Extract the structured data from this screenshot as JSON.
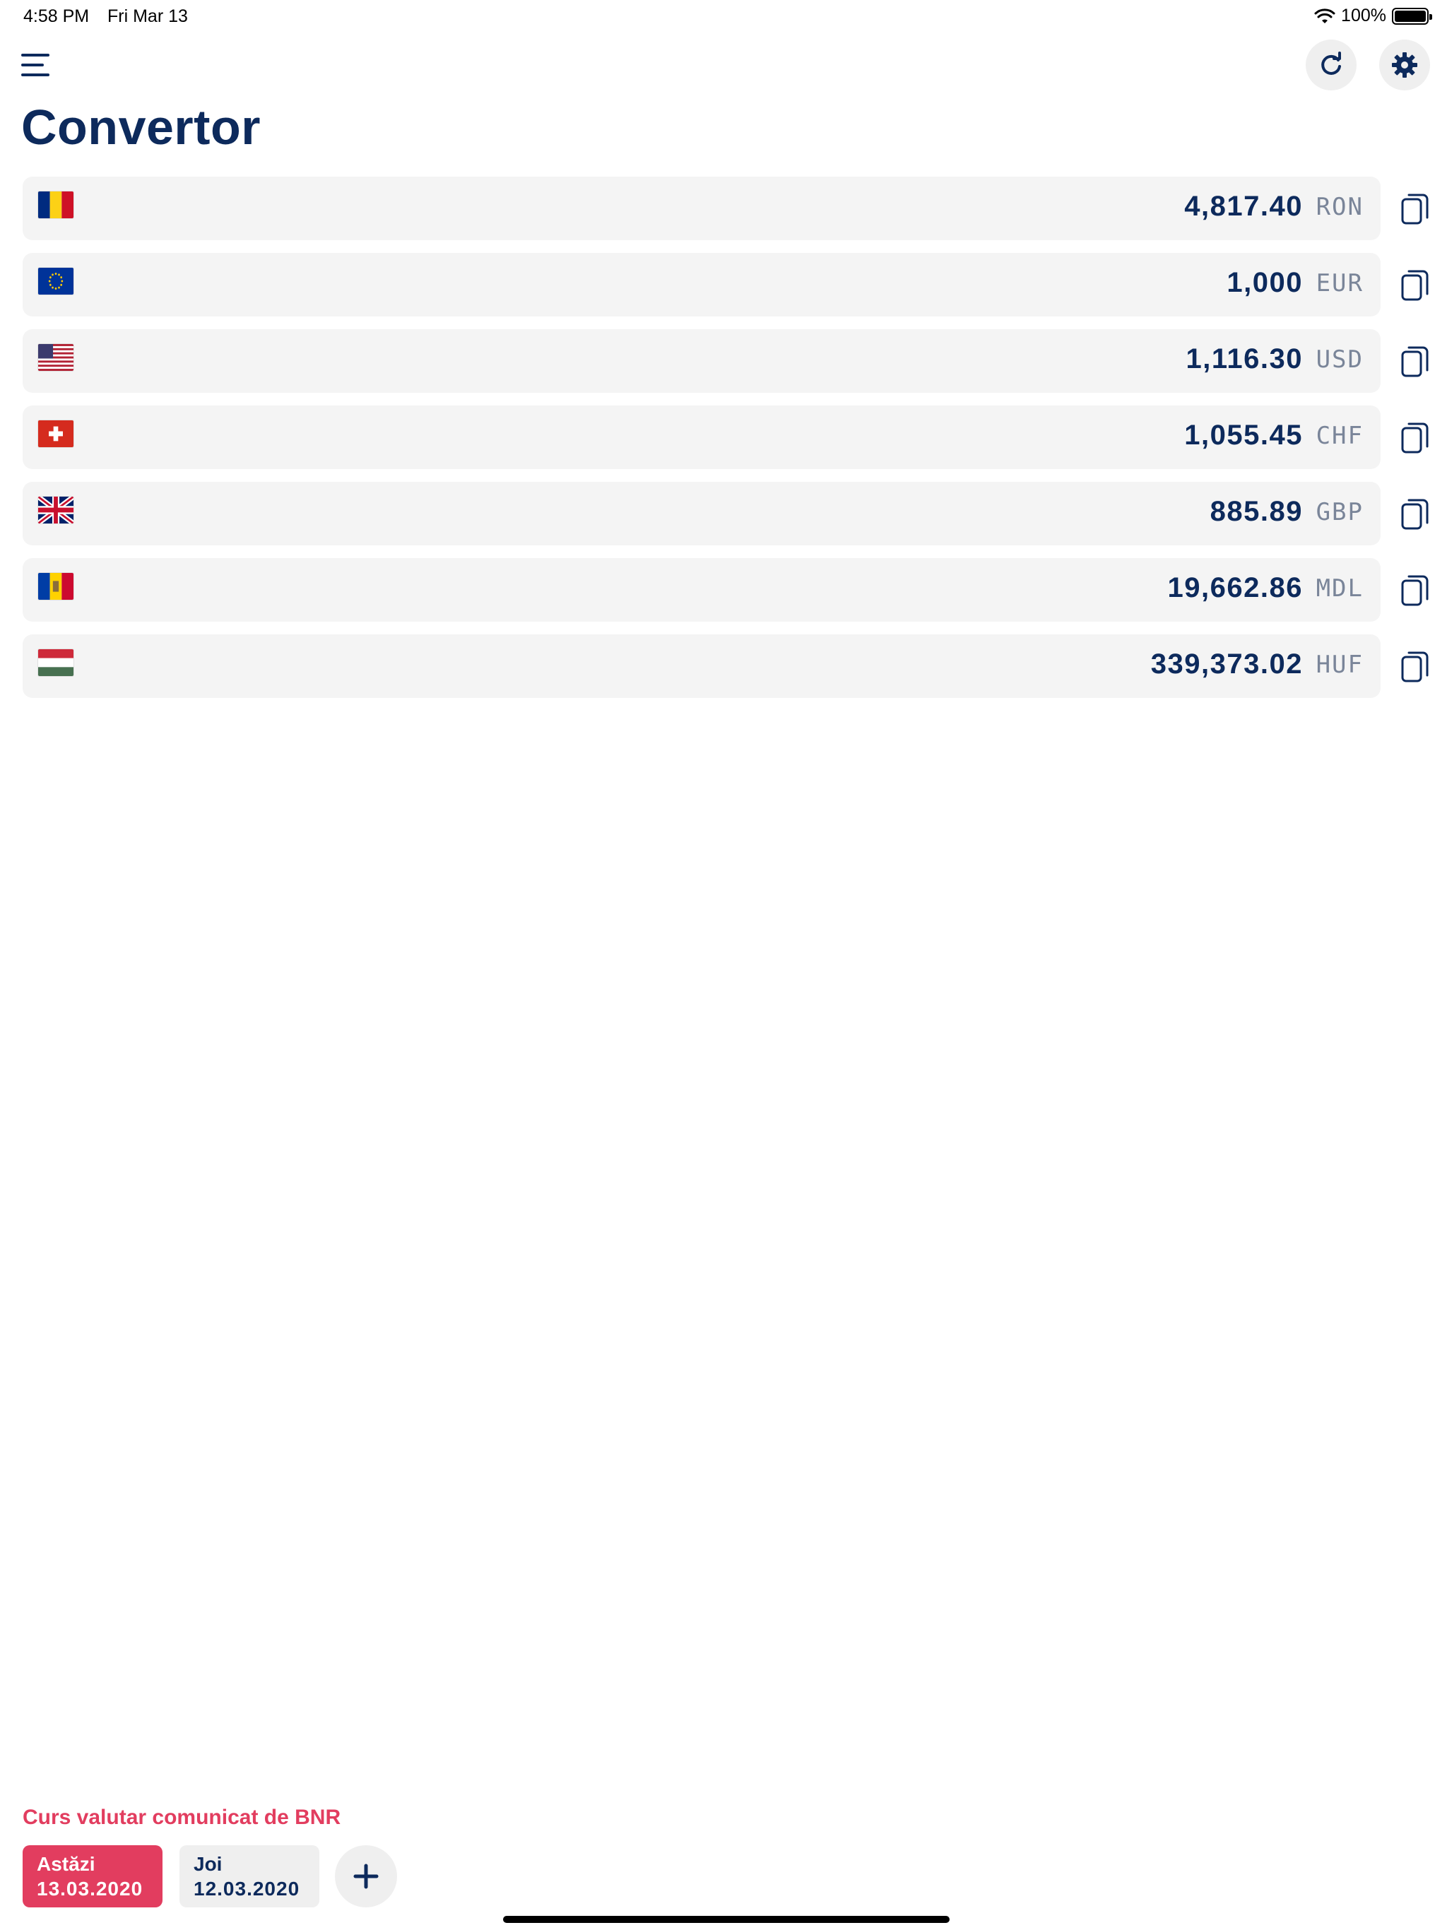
{
  "status_bar": {
    "time": "4:58 PM",
    "date": "Fri Mar 13",
    "battery": "100%"
  },
  "header": {
    "title": "Convertor",
    "menu_icon": "hamburger-menu-icon",
    "refresh_icon": "refresh-icon",
    "settings_icon": "gear-icon"
  },
  "currencies": [
    {
      "flag": "ro",
      "value": "4,817.40",
      "code": "RON"
    },
    {
      "flag": "eu",
      "value": "1,000",
      "code": "EUR"
    },
    {
      "flag": "us",
      "value": "1,116.30",
      "code": "USD"
    },
    {
      "flag": "ch",
      "value": "1,055.45",
      "code": "CHF"
    },
    {
      "flag": "gb",
      "value": "885.89",
      "code": "GBP"
    },
    {
      "flag": "md",
      "value": "19,662.86",
      "code": "MDL"
    },
    {
      "flag": "hu",
      "value": "339,373.02",
      "code": "HUF"
    }
  ],
  "footer": {
    "source_label": "Curs valutar comunicat de BNR",
    "dates": [
      {
        "day": "Astăzi",
        "date": "13.03.2020",
        "selected": true
      },
      {
        "day": "Joi",
        "date": "12.03.2020",
        "selected": false
      }
    ],
    "add_icon": "plus-icon"
  },
  "colors": {
    "primary": "#0d2a5c",
    "accent": "#e23d5f",
    "row_bg": "#f4f4f4",
    "code": "#7a8599"
  }
}
